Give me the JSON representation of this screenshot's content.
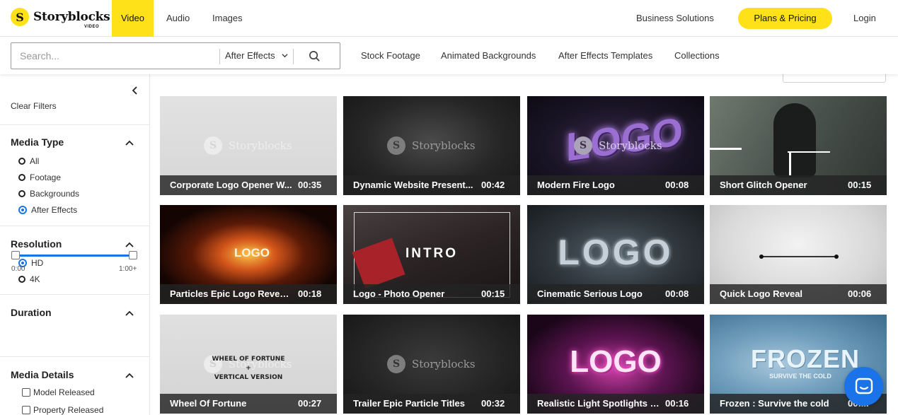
{
  "brand": {
    "name": "Storyblocks",
    "sub": "VIDEO",
    "badge": "S"
  },
  "nav": {
    "tabs": [
      {
        "label": "Video",
        "active": true
      },
      {
        "label": "Audio",
        "active": false
      },
      {
        "label": "Images",
        "active": false
      }
    ],
    "business": "Business Solutions",
    "pricing": "Plans & Pricing",
    "login": "Login"
  },
  "search": {
    "placeholder": "Search...",
    "category": "After Effects",
    "links": [
      "Stock Footage",
      "Animated Backgrounds",
      "After Effects Templates",
      "Collections"
    ]
  },
  "sidebar": {
    "clear": "Clear Filters",
    "media_type": {
      "title": "Media Type",
      "options": [
        "All",
        "Footage",
        "Backgrounds",
        "After Effects"
      ],
      "selected": "After Effects"
    },
    "resolution": {
      "title": "Resolution",
      "options": [
        "HD",
        "4K"
      ],
      "selected": "HD"
    },
    "duration": {
      "title": "Duration",
      "min_label": "0:00",
      "max_label": "1:00+"
    },
    "media_details": {
      "title": "Media Details",
      "options": [
        "Model Released",
        "Property Released"
      ]
    }
  },
  "results": [
    {
      "title": "Corporate Logo Opener W...",
      "duration": "00:35"
    },
    {
      "title": "Dynamic Website Present...",
      "duration": "00:42"
    },
    {
      "title": "Modern Fire Logo",
      "duration": "00:08"
    },
    {
      "title": "Short Glitch Opener",
      "duration": "00:15"
    },
    {
      "title": "Particles Epic Logo Reveal...",
      "duration": "00:18"
    },
    {
      "title": "Logo - Photo Opener",
      "duration": "00:15"
    },
    {
      "title": "Cinematic Serious Logo",
      "duration": "00:08"
    },
    {
      "title": "Quick Logo Reveal",
      "duration": "00:06"
    },
    {
      "title": "Wheel Of Fortune",
      "duration": "00:27"
    },
    {
      "title": "Trailer Epic Particle Titles",
      "duration": "00:32"
    },
    {
      "title": "Realistic Light Spotlights L...",
      "duration": "00:16"
    },
    {
      "title": "Frozen : Survive the cold",
      "duration": "00:..."
    }
  ],
  "thumb_text": {
    "watermark": "Storyblocks",
    "logo": "LOGO",
    "intro": "INTRO",
    "wheel_line1": "WHEEL OF FORTUNE +",
    "wheel_line2": "VERTICAL VERSION",
    "frozen": "FROZEN",
    "frozen_sub": "SURVIVE THE COLD"
  },
  "colors": {
    "accent": "#ffe11a",
    "primary_blue": "#1a73e8"
  }
}
